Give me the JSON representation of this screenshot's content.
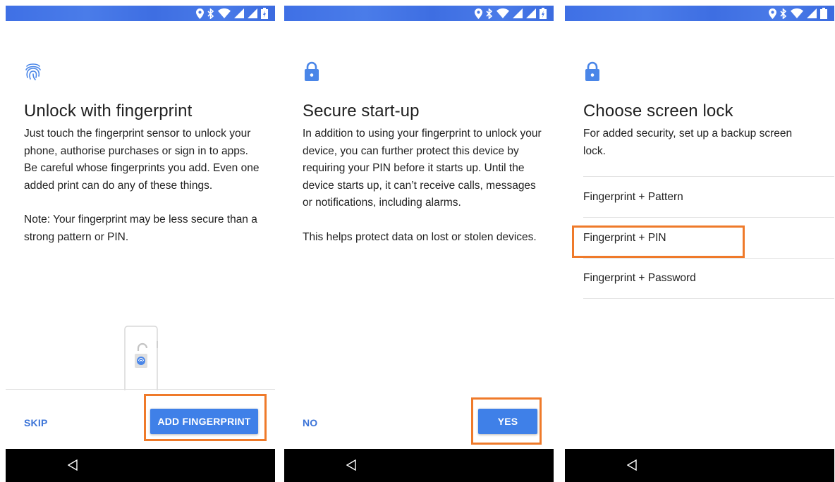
{
  "colors": {
    "accent": "#3f80e8",
    "highlight": "#ef7a2a",
    "status_bar": "#4575e6"
  },
  "screens": [
    {
      "icon": "fingerprint-icon",
      "title": "Unlock with fingerprint",
      "paragraphs": [
        "Just touch the fingerprint sensor to unlock your phone, authorise purchases or sign in to apps. Be careful whose fingerprints you add. Even one added print can do any of these things.",
        "Note: Your fingerprint may be less secure than a strong pattern or PIN."
      ],
      "secondary_button": "SKIP",
      "primary_button": "ADD FINGERPRINT"
    },
    {
      "icon": "lock-icon",
      "title": "Secure start-up",
      "paragraphs": [
        "In addition to using your fingerprint to unlock your device, you can further protect this device by requiring your PIN before it starts up. Until the device starts up, it can’t receive calls, messages or notifications, including alarms.",
        "This helps protect data on lost or stolen devices."
      ],
      "secondary_button": "NO",
      "primary_button": "YES"
    },
    {
      "icon": "lock-icon",
      "title": "Choose screen lock",
      "paragraphs": [
        "For added security, set up a backup screen lock."
      ],
      "options": [
        "Fingerprint + Pattern",
        "Fingerprint + PIN",
        "Fingerprint + Password"
      ]
    }
  ]
}
